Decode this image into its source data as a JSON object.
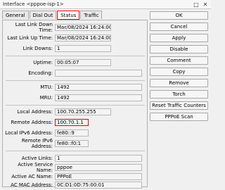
{
  "window": {
    "title": "Interface <pppoe-isp-1>",
    "close_glyph": "✕",
    "restore_glyph": "□"
  },
  "tabs": [
    {
      "label": "General"
    },
    {
      "label": "Dial Out"
    },
    {
      "label": "Status",
      "active": true
    },
    {
      "label": "Traffic"
    }
  ],
  "status": {
    "last_link_down_time": {
      "label": "Last Link Down Time:",
      "value": "Mar/08/2024 16:24:00"
    },
    "last_link_up_time": {
      "label": "Last Link Up Time:",
      "value": "Mar/08/2024 16:24:00"
    },
    "link_downs": {
      "label": "Link Downs:",
      "value": "1"
    },
    "uptime": {
      "label": "Uptime:",
      "value": "00:05:07"
    },
    "encoding": {
      "label": "Encoding:",
      "value": ""
    },
    "mtu": {
      "label": "MTU:",
      "value": "1492"
    },
    "mru": {
      "label": "MRU:",
      "value": "1492"
    },
    "local_address": {
      "label": "Local Address:",
      "value": "100.70.255.255"
    },
    "remote_address": {
      "label": "Remote Address:",
      "value": "100.70.1.1"
    },
    "local_ipv6": {
      "label": "Local IPv6 Address:",
      "value": "fe80::9"
    },
    "remote_ipv6": {
      "label": "Remote IPv6 Address:",
      "value": "fe80::f0:1"
    },
    "active_links": {
      "label": "Active Links:",
      "value": "1"
    },
    "active_service_name": {
      "label": "Active Service Name:",
      "value": "pppoe"
    },
    "active_ac_name": {
      "label": "Active AC Name:",
      "value": "PPPoE"
    },
    "ac_mac_address": {
      "label": "AC MAC Address:",
      "value": "0C:D1:0D:75:00:01"
    }
  },
  "buttons": {
    "ok": "OK",
    "cancel": "Cancel",
    "apply": "Apply",
    "disable": "Disable",
    "comment": "Comment",
    "copy": "Copy",
    "remove": "Remove",
    "torch": "Torch",
    "reset_traffic_counters": "Reset Traffic Counters",
    "pppoe_scan": "PPPoE Scan"
  },
  "colors": {
    "highlight": "#e00000"
  }
}
